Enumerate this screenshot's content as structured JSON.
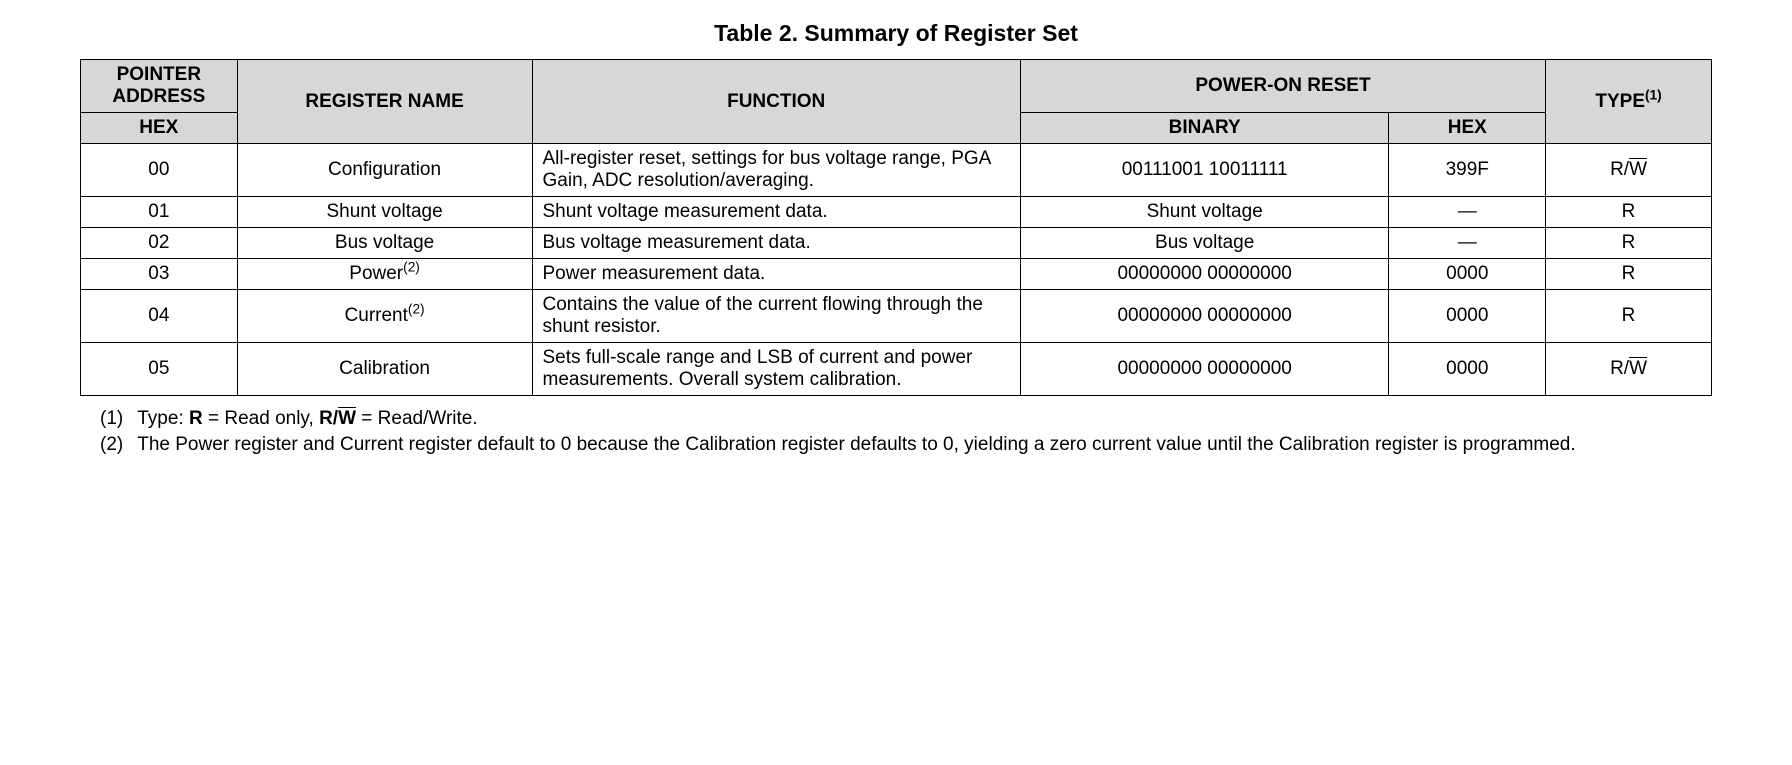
{
  "title": "Table 2. Summary of Register Set",
  "headers": {
    "pointer_address": "POINTER ADDRESS",
    "hex": "HEX",
    "register_name": "REGISTER NAME",
    "function": "FUNCTION",
    "power_on_reset": "POWER-ON RESET",
    "binary": "BINARY",
    "hex_val": "HEX",
    "type": "TYPE",
    "type_sup": "(1)"
  },
  "rows": [
    {
      "hex": "00",
      "name": "Configuration",
      "name_sup": "",
      "function": "All-register reset, settings for bus voltage range, PGA Gain, ADC resolution/averaging.",
      "binary": "00111001 10011111",
      "hex_val": "399F",
      "type_pre": "R/",
      "type_over": "W"
    },
    {
      "hex": "01",
      "name": "Shunt voltage",
      "name_sup": "",
      "function": "Shunt voltage measurement data.",
      "binary": "Shunt voltage",
      "hex_val": "—",
      "type_pre": "R",
      "type_over": ""
    },
    {
      "hex": "02",
      "name": "Bus voltage",
      "name_sup": "",
      "function": "Bus voltage measurement data.",
      "binary": "Bus voltage",
      "hex_val": "—",
      "type_pre": "R",
      "type_over": ""
    },
    {
      "hex": "03",
      "name": "Power",
      "name_sup": "(2)",
      "function": "Power measurement data.",
      "binary": "00000000 00000000",
      "hex_val": "0000",
      "type_pre": "R",
      "type_over": ""
    },
    {
      "hex": "04",
      "name": "Current",
      "name_sup": "(2)",
      "function": "Contains the value of the current flowing through the shunt resistor.",
      "binary": "00000000 00000000",
      "hex_val": "0000",
      "type_pre": "R",
      "type_over": ""
    },
    {
      "hex": "05",
      "name": "Calibration",
      "name_sup": "",
      "function": "Sets full-scale range and LSB of current and power measurements. Overall system calibration.",
      "binary": "00000000 00000000",
      "hex_val": "0000",
      "type_pre": "R/",
      "type_over": "W"
    }
  ],
  "footnotes": [
    {
      "num": "(1)",
      "text_pre": "Type: ",
      "text_bold1": "R",
      "text_mid1": " = Read only, ",
      "text_bold2_pre": "R/",
      "text_bold2_over": "W",
      "text_post": " = Read/Write."
    },
    {
      "num": "(2)",
      "text_pre": "The Power register and Current register default to 0 because the Calibration register defaults to 0, yielding a zero current value until the Calibration register is programmed.",
      "text_bold1": "",
      "text_mid1": "",
      "text_bold2_pre": "",
      "text_bold2_over": "",
      "text_post": ""
    }
  ]
}
